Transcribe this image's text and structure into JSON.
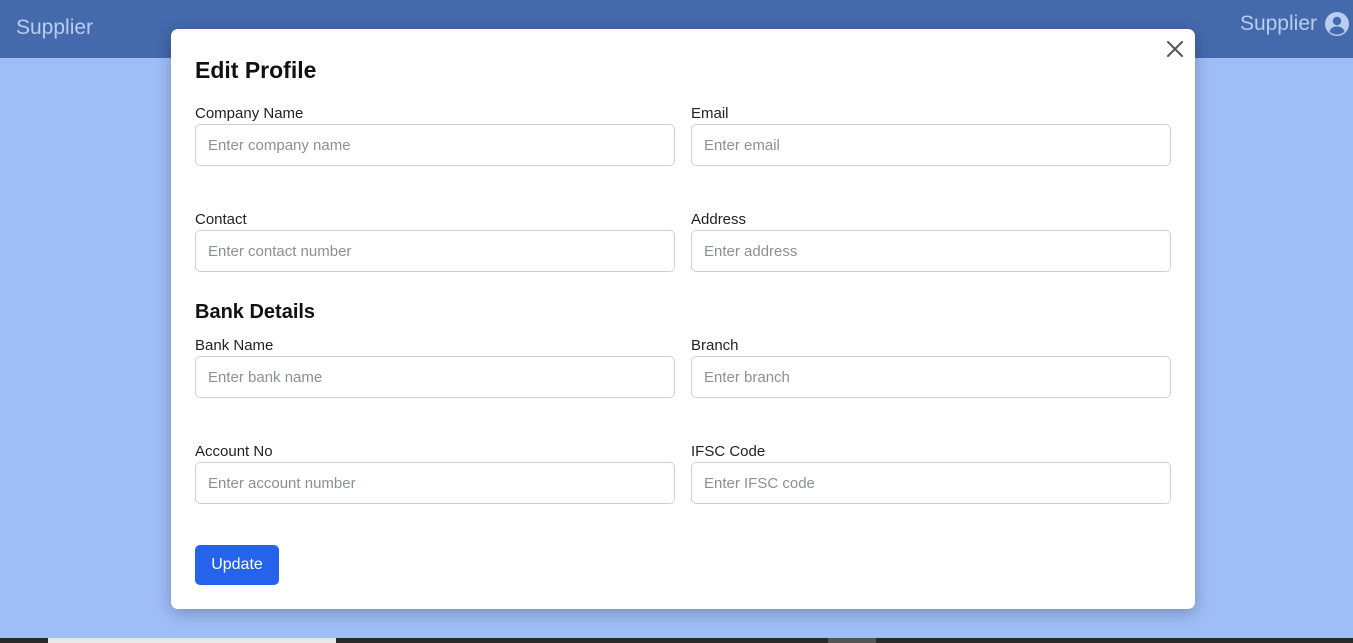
{
  "navbar": {
    "brand": "Supplier",
    "user_label": "Supplier",
    "user_icon": "user-circle-icon"
  },
  "modal": {
    "title": "Edit Profile",
    "close_icon": "close-icon",
    "fields": {
      "company_name": {
        "label": "Company Name",
        "placeholder": "Enter company name",
        "value": ""
      },
      "email": {
        "label": "Email",
        "placeholder": "Enter email",
        "value": ""
      },
      "contact": {
        "label": "Contact",
        "placeholder": "Enter contact number",
        "value": ""
      },
      "address": {
        "label": "Address",
        "placeholder": "Enter address",
        "value": ""
      }
    },
    "bank_section_title": "Bank Details",
    "bank_fields": {
      "bank_name": {
        "label": "Bank Name",
        "placeholder": "Enter bank name",
        "value": ""
      },
      "branch": {
        "label": "Branch",
        "placeholder": "Enter branch",
        "value": ""
      },
      "account_no": {
        "label": "Account No",
        "placeholder": "Enter account number",
        "value": ""
      },
      "ifsc_code": {
        "label": "IFSC Code",
        "placeholder": "Enter IFSC code",
        "value": ""
      }
    },
    "update_label": "Update"
  },
  "colors": {
    "navbar": "#4469ad",
    "backdrop": "#9fbdf7",
    "primary_button": "#2563eb"
  }
}
